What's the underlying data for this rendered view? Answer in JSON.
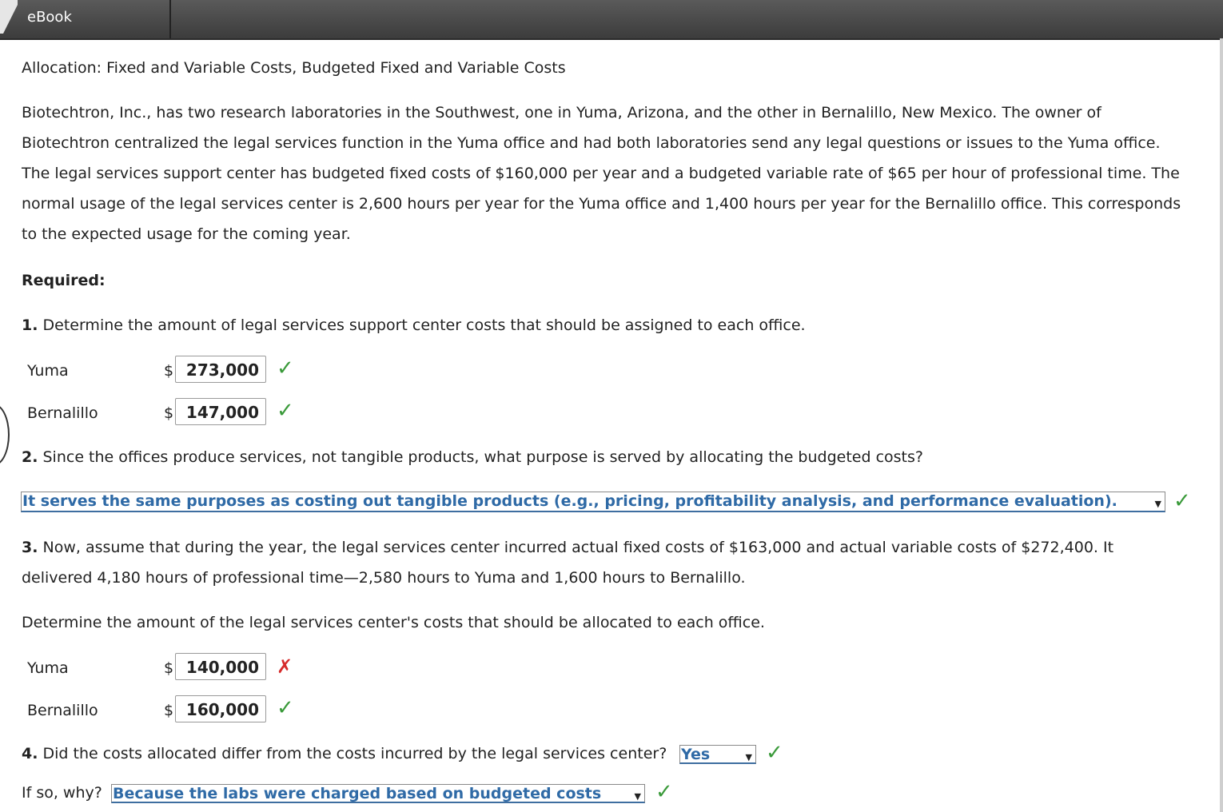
{
  "header": {
    "tab_label": "eBook"
  },
  "problem": {
    "title": "Allocation: Fixed and Variable Costs, Budgeted Fixed and Variable Costs",
    "intro_lines": [
      "Biotechtron, Inc., has two research laboratories in the Southwest, one in Yuma, Arizona, and the other in Bernalillo, New Mexico. The owner of",
      "Biotechtron centralized the legal services function in the Yuma office and had both laboratories send any legal questions or issues to the Yuma office.",
      "The legal services support center has budgeted fixed costs of $160,000 per year and a budgeted variable rate of $65 per hour of professional time. The",
      "normal usage of the legal services center is 2,600 hours per year for the Yuma office and 1,400 hours per year for the Bernalillo office. This corresponds",
      "to the expected usage for the coming year."
    ],
    "required_label": "Required:"
  },
  "q1": {
    "number": "1.",
    "text": " Determine the amount of legal services support center costs that should be assigned to each office.",
    "rows": [
      {
        "label": "Yuma",
        "currency": "$",
        "value": "273,000",
        "mark": "✓"
      },
      {
        "label": "Bernalillo",
        "currency": "$",
        "value": "147,000",
        "mark": "✓"
      }
    ]
  },
  "q2": {
    "number": "2.",
    "text": " Since the offices produce services, not tangible products, what purpose is served by allocating the budgeted costs?",
    "selected": "It serves the same purposes as costing out tangible products (e.g., pricing, profitability analysis, and performance evaluation).",
    "mark": "✓"
  },
  "q3": {
    "number": "3.",
    "line1": " Now, assume that during the year, the legal services center incurred actual fixed costs of $163,000 and actual variable costs of $272,400. It",
    "line2": "delivered 4,180 hours of professional time—2,580 hours to Yuma and 1,600 hours to Bernalillo.",
    "instruction": "Determine the amount of the legal services center's costs that should be allocated to each office.",
    "rows": [
      {
        "label": "Yuma",
        "currency": "$",
        "value": "140,000",
        "mark": "✗"
      },
      {
        "label": "Bernalillo",
        "currency": "$",
        "value": "160,000",
        "mark": "✓"
      }
    ]
  },
  "q4": {
    "number": "4.",
    "text": " Did the costs allocated differ from the costs incurred by the legal services center?",
    "selected": "Yes",
    "mark": "✓",
    "why_label": "If so, why?",
    "why_selected": "Because the labs were charged based on budgeted costs",
    "why_mark": "✓"
  },
  "colors": {
    "correct": "#3a9a3a",
    "incorrect": "#d62b2b",
    "link": "#2f6aa6",
    "header_bg": "#4a4a4a"
  }
}
